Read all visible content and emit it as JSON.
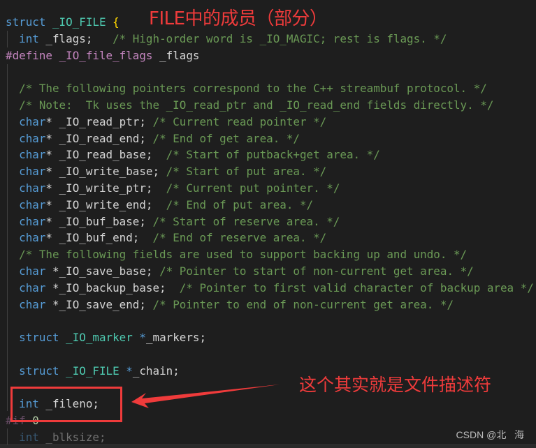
{
  "code": {
    "lines": [
      {
        "parts": [
          [
            "kw",
            "struct"
          ],
          [
            "var",
            " "
          ],
          [
            "ty",
            "_IO_FILE"
          ],
          [
            "var",
            " "
          ],
          [
            "brace",
            "{"
          ]
        ]
      },
      {
        "parts": [
          [
            "var",
            "  "
          ],
          [
            "kw",
            "int"
          ],
          [
            "var",
            " _flags;"
          ],
          [
            "var",
            "   "
          ],
          [
            "cm",
            "/* High-order word is _IO_MAGIC; rest is flags. */"
          ]
        ]
      },
      {
        "parts": [
          [
            "pp",
            "#define"
          ],
          [
            "var",
            " "
          ],
          [
            "macro",
            "_IO_file_flags"
          ],
          [
            "var",
            " _flags"
          ]
        ]
      },
      {
        "parts": [
          [
            "var",
            ""
          ]
        ]
      },
      {
        "parts": [
          [
            "var",
            "  "
          ],
          [
            "cm",
            "/* The following pointers correspond to the C++ streambuf protocol. */"
          ]
        ]
      },
      {
        "parts": [
          [
            "var",
            "  "
          ],
          [
            "cm",
            "/* Note:  Tk uses the _IO_read_ptr and _IO_read_end fields directly. */"
          ]
        ]
      },
      {
        "parts": [
          [
            "var",
            "  "
          ],
          [
            "kw",
            "char"
          ],
          [
            "var",
            "* _IO_read_ptr; "
          ],
          [
            "cm",
            "/* Current read pointer */"
          ]
        ]
      },
      {
        "parts": [
          [
            "var",
            "  "
          ],
          [
            "kw",
            "char"
          ],
          [
            "var",
            "* _IO_read_end; "
          ],
          [
            "cm",
            "/* End of get area. */"
          ]
        ]
      },
      {
        "parts": [
          [
            "var",
            "  "
          ],
          [
            "kw",
            "char"
          ],
          [
            "var",
            "* _IO_read_base;  "
          ],
          [
            "cm",
            "/* Start of putback+get area. */"
          ]
        ]
      },
      {
        "parts": [
          [
            "var",
            "  "
          ],
          [
            "kw",
            "char"
          ],
          [
            "var",
            "* _IO_write_base; "
          ],
          [
            "cm",
            "/* Start of put area. */"
          ]
        ]
      },
      {
        "parts": [
          [
            "var",
            "  "
          ],
          [
            "kw",
            "char"
          ],
          [
            "var",
            "* _IO_write_ptr;  "
          ],
          [
            "cm",
            "/* Current put pointer. */"
          ]
        ]
      },
      {
        "parts": [
          [
            "var",
            "  "
          ],
          [
            "kw",
            "char"
          ],
          [
            "var",
            "* _IO_write_end;  "
          ],
          [
            "cm",
            "/* End of put area. */"
          ]
        ]
      },
      {
        "parts": [
          [
            "var",
            "  "
          ],
          [
            "kw",
            "char"
          ],
          [
            "var",
            "* _IO_buf_base; "
          ],
          [
            "cm",
            "/* Start of reserve area. */"
          ]
        ]
      },
      {
        "parts": [
          [
            "var",
            "  "
          ],
          [
            "kw",
            "char"
          ],
          [
            "var",
            "* _IO_buf_end;  "
          ],
          [
            "cm",
            "/* End of reserve area. */"
          ]
        ]
      },
      {
        "parts": [
          [
            "var",
            "  "
          ],
          [
            "cm",
            "/* The following fields are used to support backing up and undo. */"
          ]
        ]
      },
      {
        "parts": [
          [
            "var",
            "  "
          ],
          [
            "kw",
            "char"
          ],
          [
            "var",
            " *_IO_save_base; "
          ],
          [
            "cm",
            "/* Pointer to start of non-current get area. */"
          ]
        ]
      },
      {
        "parts": [
          [
            "var",
            "  "
          ],
          [
            "kw",
            "char"
          ],
          [
            "var",
            " *_IO_backup_base;  "
          ],
          [
            "cm",
            "/* Pointer to first valid character of backup area */"
          ]
        ]
      },
      {
        "parts": [
          [
            "var",
            "  "
          ],
          [
            "kw",
            "char"
          ],
          [
            "var",
            " *_IO_save_end; "
          ],
          [
            "cm",
            "/* Pointer to end of non-current get area. */"
          ]
        ]
      },
      {
        "parts": [
          [
            "var",
            ""
          ]
        ]
      },
      {
        "parts": [
          [
            "var",
            "  "
          ],
          [
            "kw",
            "struct"
          ],
          [
            "var",
            " "
          ],
          [
            "ty",
            "_IO_marker"
          ],
          [
            "var",
            " "
          ],
          [
            "kw",
            "*"
          ],
          [
            "var",
            "_markers;"
          ]
        ]
      },
      {
        "parts": [
          [
            "var",
            ""
          ]
        ]
      },
      {
        "parts": [
          [
            "var",
            "  "
          ],
          [
            "kw",
            "struct"
          ],
          [
            "var",
            " "
          ],
          [
            "ty",
            "_IO_FILE"
          ],
          [
            "var",
            " "
          ],
          [
            "kw",
            "*"
          ],
          [
            "var",
            "_chain;"
          ]
        ]
      },
      {
        "parts": [
          [
            "var",
            ""
          ]
        ]
      },
      {
        "parts": [
          [
            "var",
            "  "
          ],
          [
            "kw",
            "int"
          ],
          [
            "var",
            " _fileno;"
          ]
        ]
      },
      {
        "parts": [
          [
            "pp dim",
            "#if"
          ],
          [
            "var dim",
            " "
          ],
          [
            "num",
            "0"
          ]
        ]
      },
      {
        "parts": [
          [
            "var dim",
            "  "
          ],
          [
            "kw dim",
            "int"
          ],
          [
            "var dim",
            " _blksize;"
          ]
        ]
      }
    ]
  },
  "annotations": {
    "title": "FILE中的成员（部分）",
    "note": "这个其实就是文件描述符",
    "highlight_target": "int _fileno;",
    "color": "#ef3b3b"
  },
  "watermark": "CSDN @北   海"
}
